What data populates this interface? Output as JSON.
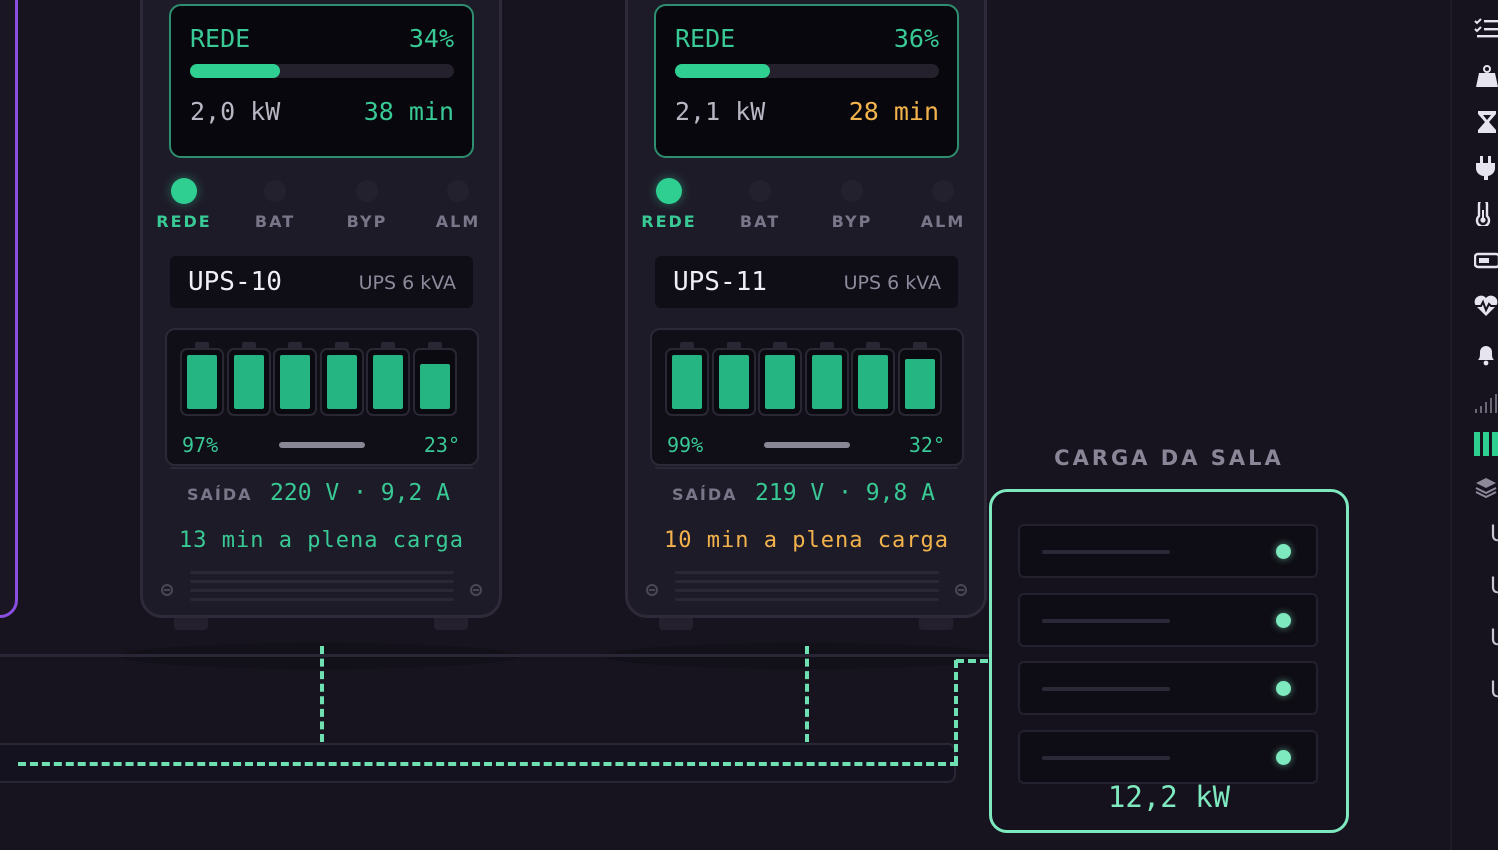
{
  "ups_units": [
    {
      "screen_label": "REDE",
      "load_percent": "34%",
      "load_fraction": 0.34,
      "power": "2,0 kW",
      "runtime_short": "38 min",
      "runtime_color": "#38c995",
      "leds": [
        {
          "label": "REDE",
          "on": true
        },
        {
          "label": "BAT",
          "on": false
        },
        {
          "label": "BYP",
          "on": false
        },
        {
          "label": "ALM",
          "on": false
        }
      ],
      "name": "UPS-10",
      "model": "UPS 6 kVA",
      "battery_cells": [
        1,
        1,
        1,
        1,
        1,
        0.84
      ],
      "battery_charge": "97%",
      "battery_temp": "23°",
      "output_label": "SAÍDA",
      "output_value": "220 V · 9,2 A",
      "runtime_full": "13 min a plena carga",
      "runtime_full_color": "#38c995"
    },
    {
      "screen_label": "REDE",
      "load_percent": "36%",
      "load_fraction": 0.36,
      "power": "2,1 kW",
      "runtime_short": "28 min",
      "runtime_color": "#f3b34c",
      "leds": [
        {
          "label": "REDE",
          "on": true
        },
        {
          "label": "BAT",
          "on": false
        },
        {
          "label": "BYP",
          "on": false
        },
        {
          "label": "ALM",
          "on": false
        }
      ],
      "name": "UPS-11",
      "model": "UPS 6 kVA",
      "battery_cells": [
        1,
        1,
        1,
        1,
        1,
        0.92
      ],
      "battery_charge": "99%",
      "battery_temp": "32°",
      "output_label": "SAÍDA",
      "output_value": "219 V · 9,8 A",
      "runtime_full": "10 min a plena carga",
      "runtime_full_color": "#f3b34c"
    }
  ],
  "room_load": {
    "title": "CARGA DA SALA",
    "total": "12,2 kW",
    "racks": 4
  },
  "rail": {
    "icons": [
      "checklist-icon",
      "weight-icon",
      "hourglass-icon",
      "plug-icon",
      "thermometer-icon",
      "battery-icon",
      "heartbeat-icon",
      "bell-icon",
      "signal-icon",
      "bars-chart-icon",
      "layers-icon"
    ],
    "tabs": [
      "U",
      "U",
      "U",
      "U"
    ]
  },
  "colors": {
    "accent": "#38c995",
    "warning": "#f3b34c",
    "purple": "#8a4fe0",
    "room_border": "#7ee8bf"
  }
}
